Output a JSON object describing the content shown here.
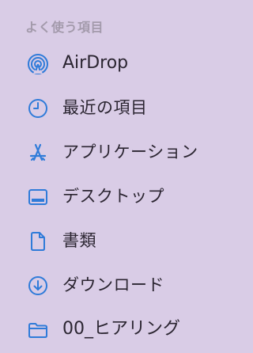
{
  "sidebar": {
    "section_title": "よく使う項目",
    "accent_color": "#2f7bd9",
    "items": [
      {
        "label": "AirDrop",
        "icon": "airdrop-icon"
      },
      {
        "label": "最近の項目",
        "icon": "clock-icon"
      },
      {
        "label": "アプリケーション",
        "icon": "applications-icon"
      },
      {
        "label": "デスクトップ",
        "icon": "desktop-icon"
      },
      {
        "label": "書類",
        "icon": "document-icon"
      },
      {
        "label": "ダウンロード",
        "icon": "download-icon"
      },
      {
        "label": "00_ヒアリング",
        "icon": "folder-icon"
      }
    ]
  }
}
